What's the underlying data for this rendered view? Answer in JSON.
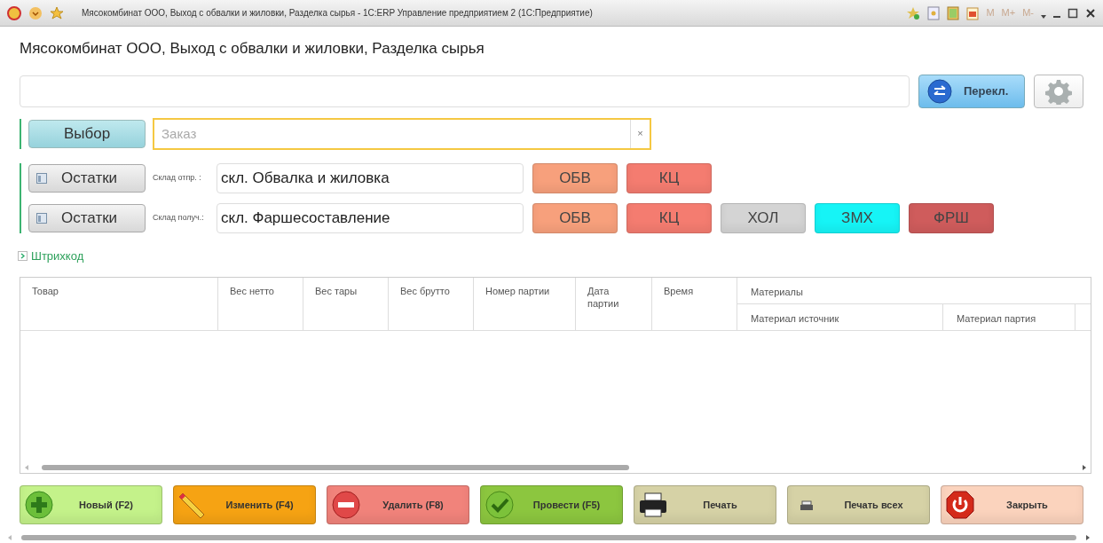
{
  "window": {
    "title": "Мясокомбинат ООО, Выход с обвалки и жиловки, Разделка сырья - 1С:ERP Управление предприятием 2  (1С:Предприятие)",
    "memory_buttons": [
      "M",
      "M+",
      "M-"
    ]
  },
  "heading": "Мясокомбинат ООО, Выход с обвалки и жиловки, Разделка сырья",
  "switch_button": "Перекл.",
  "choose_button": "Выбор",
  "order_field": {
    "placeholder": "Заказ",
    "clear": "×"
  },
  "warehouses": [
    {
      "button": "Остатки",
      "label": "Склад отпр. :",
      "value": "скл. Обвалка и жиловка",
      "quick": [
        {
          "label": "ОБВ",
          "color": "#f7a07c"
        },
        {
          "label": "КЦ",
          "color": "#f47c70"
        }
      ]
    },
    {
      "button": "Остатки",
      "label": "Склад получ.:",
      "value": "скл. Фаршесоставление",
      "quick": [
        {
          "label": "ОБВ",
          "color": "#f7a07c"
        },
        {
          "label": "КЦ",
          "color": "#f47c70"
        },
        {
          "label": "ХОЛ",
          "color": "#d4d4d4"
        },
        {
          "label": "ЗМХ",
          "color": "#16f4f6"
        },
        {
          "label": "ФРШ",
          "color": "#cf5c5c"
        }
      ]
    }
  ],
  "barcode_group": {
    "label": "Штрихкод",
    "expanded": false
  },
  "table": {
    "columns": [
      "Товар",
      "Вес нетто",
      "Вес тары",
      "Вес брутто",
      "Номер партии",
      "Дата партии",
      "Время"
    ],
    "group": {
      "label": "Материалы",
      "columns": [
        "Материал источник",
        "Материал партия"
      ]
    }
  },
  "actions": [
    {
      "label": "Новый (F2)",
      "kind": "plus",
      "color": "#c4f28a"
    },
    {
      "label": "Изменить (F4)",
      "kind": "pencil",
      "color": "#f6a313"
    },
    {
      "label": "Удалить (F8)",
      "kind": "minus",
      "color": "#f1837b"
    },
    {
      "label": "Провести (F5)",
      "kind": "check",
      "color": "#8cc63f"
    },
    {
      "label": "Печать",
      "kind": "printer",
      "color": "#d6d2a6"
    },
    {
      "label": "Печать всех",
      "kind": "small-printer",
      "color": "#d6d2a6"
    },
    {
      "label": "Закрыть",
      "kind": "power",
      "color": "#fbd3bd"
    }
  ]
}
